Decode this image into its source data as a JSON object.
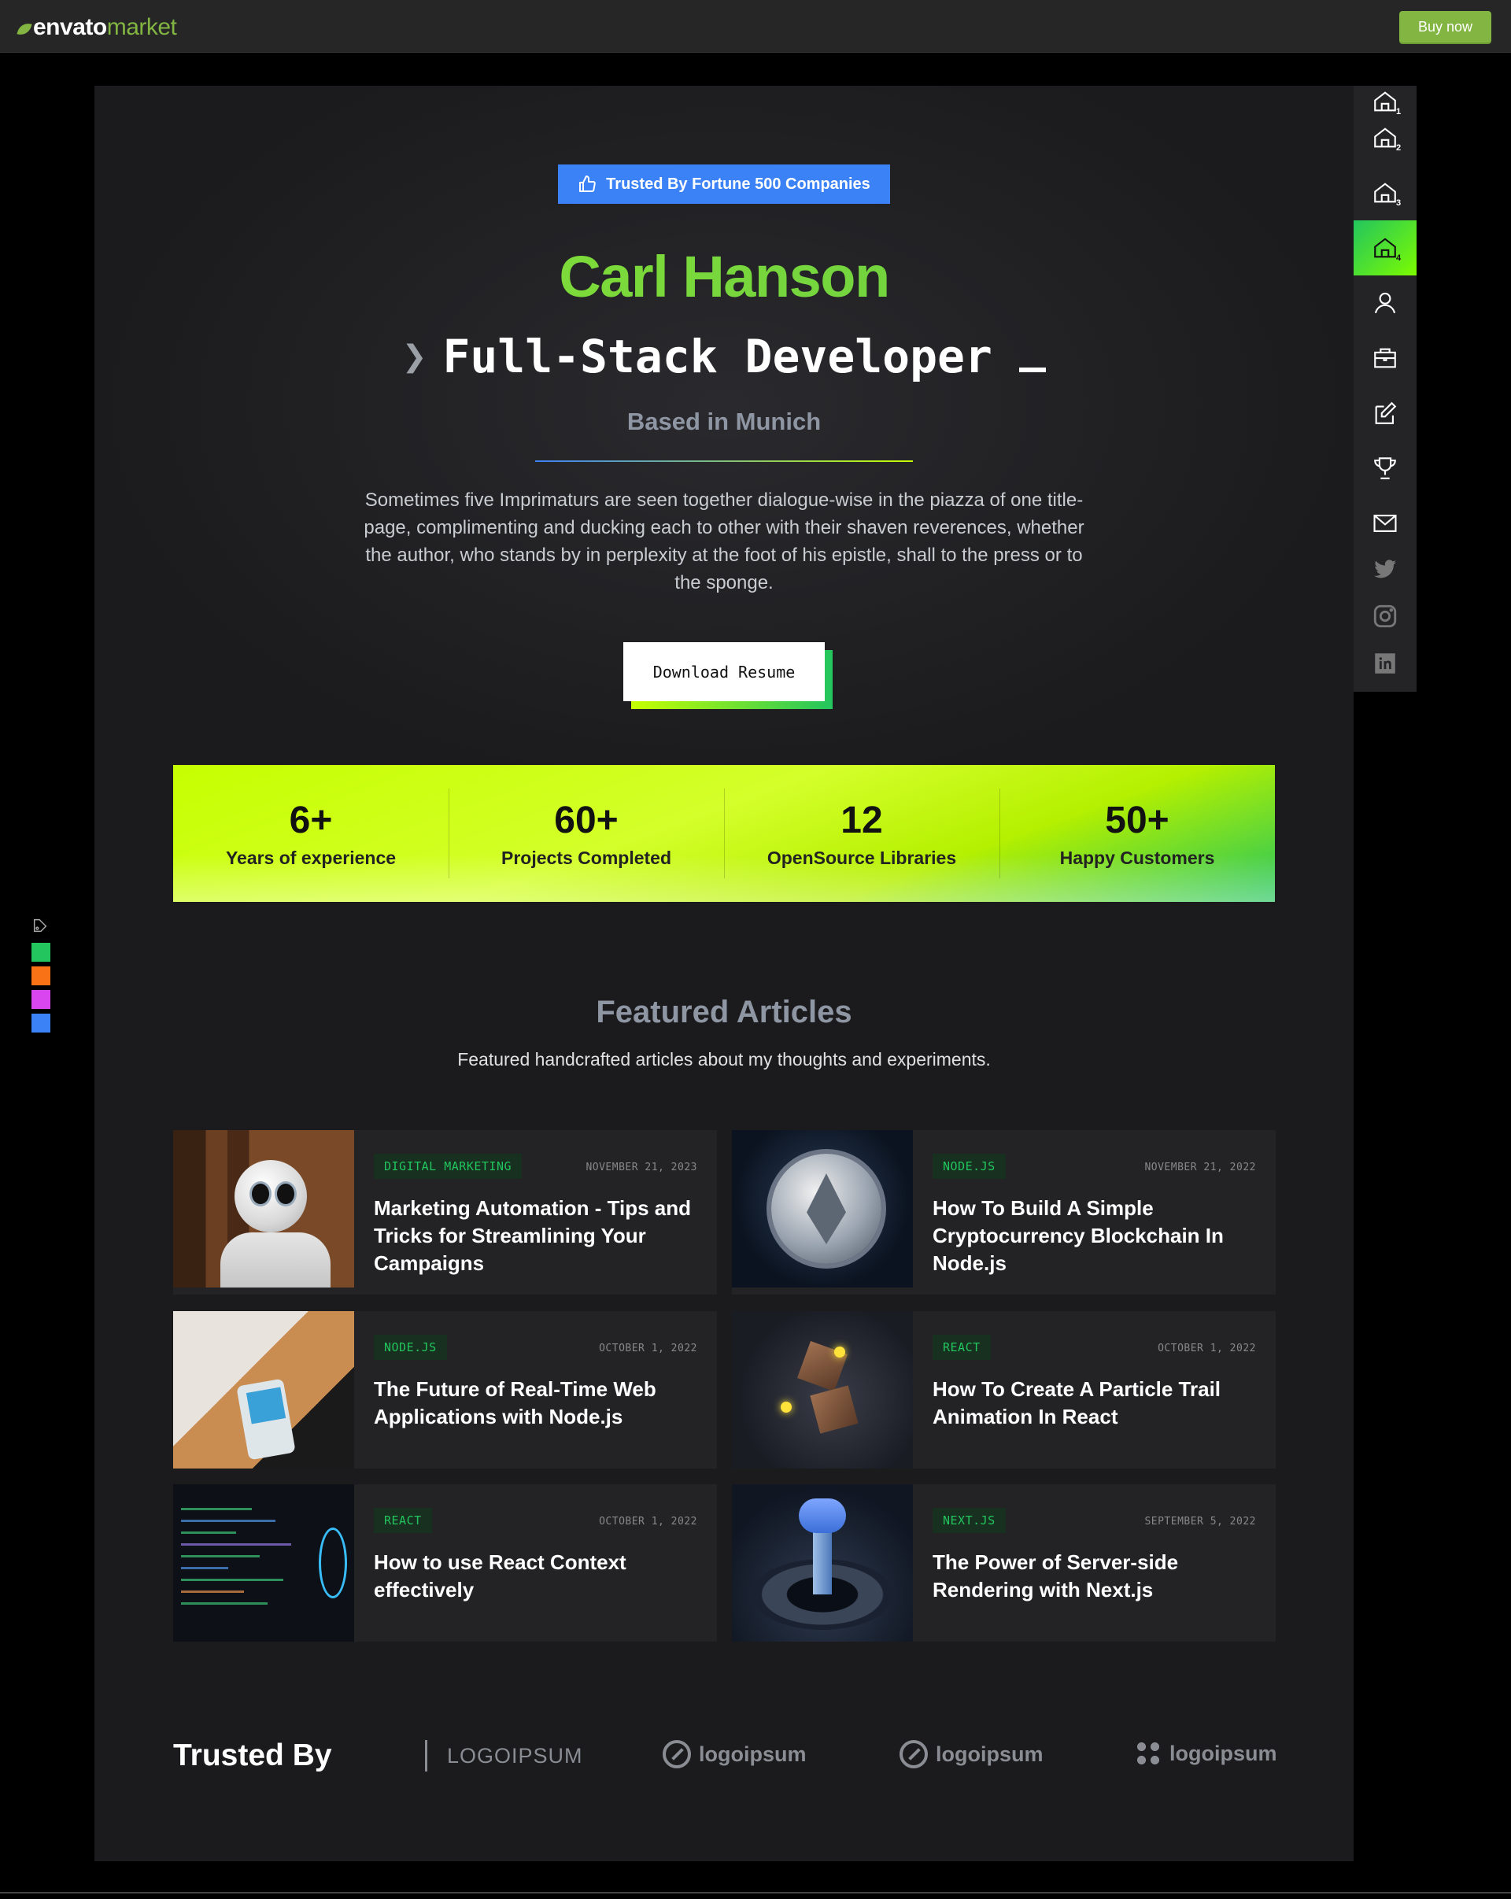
{
  "topbar": {
    "logo_envato": "envato",
    "logo_market": "market",
    "buy_label": "Buy now"
  },
  "hero": {
    "badge": "Trusted By Fortune 500 Companies",
    "name": "Carl Hanson",
    "role": "Full-Stack Developer",
    "location": "Based in Munich",
    "bio": "Sometimes five Imprimaturs are seen together dialogue-wise in the piazza of one title-page, complimenting and ducking each to other with their shaven reverences, whether the author, who stands by in perplexity at the foot of his epistle, shall to the press or to the sponge.",
    "download_label": "Download Resume"
  },
  "stats": [
    {
      "value": "6+",
      "label": "Years of experience"
    },
    {
      "value": "60+",
      "label": "Projects Completed"
    },
    {
      "value": "12",
      "label": "OpenSource Libraries"
    },
    {
      "value": "50+",
      "label": "Happy Customers"
    }
  ],
  "featured": {
    "title": "Featured Articles",
    "subtitle": "Featured handcrafted articles about my thoughts and experiments.",
    "articles": [
      {
        "tag": "DIGITAL MARKETING",
        "date": "NOVEMBER 21, 2023",
        "title": "Marketing Automation - Tips and Tricks for Streamlining Your Campaigns"
      },
      {
        "tag": "NODE.JS",
        "date": "NOVEMBER 21, 2022",
        "title": "How To Build A Simple Cryptocurrency Blockchain In Node.js"
      },
      {
        "tag": "NODE.JS",
        "date": "OCTOBER 1, 2022",
        "title": "The Future of Real-Time Web Applications with Node.js"
      },
      {
        "tag": "REACT",
        "date": "OCTOBER 1, 2022",
        "title": "How To Create A Particle Trail Animation In React"
      },
      {
        "tag": "REACT",
        "date": "OCTOBER 1, 2022",
        "title": "How to use React Context effectively"
      },
      {
        "tag": "NEXT.JS",
        "date": "SEPTEMBER 5, 2022",
        "title": "The Power of Server-side Rendering with Next.js"
      }
    ]
  },
  "trusted": {
    "title": "Trusted By",
    "brands": [
      "LOGOIPSUM",
      "logoipsum",
      "logoipsum",
      "logoipsum"
    ]
  },
  "rail": {
    "items": [
      {
        "icon": "home-icon",
        "sub": "1"
      },
      {
        "icon": "home-icon",
        "sub": "2"
      },
      {
        "icon": "home-icon",
        "sub": "3"
      },
      {
        "icon": "home-icon",
        "sub": "4",
        "active": true
      },
      {
        "icon": "user-icon"
      },
      {
        "icon": "briefcase-icon"
      },
      {
        "icon": "edit-icon"
      },
      {
        "icon": "trophy-icon"
      },
      {
        "icon": "mail-icon"
      },
      {
        "icon": "twitter-icon"
      },
      {
        "icon": "instagram-icon"
      },
      {
        "icon": "linkedin-icon"
      }
    ]
  },
  "swatches": [
    "#22c55e",
    "#f97316",
    "#d946ef",
    "#3b82f6"
  ],
  "colors": {
    "accent": "#7ed321",
    "badge_blue": "#3b82f6",
    "envato_green": "#82b541"
  }
}
